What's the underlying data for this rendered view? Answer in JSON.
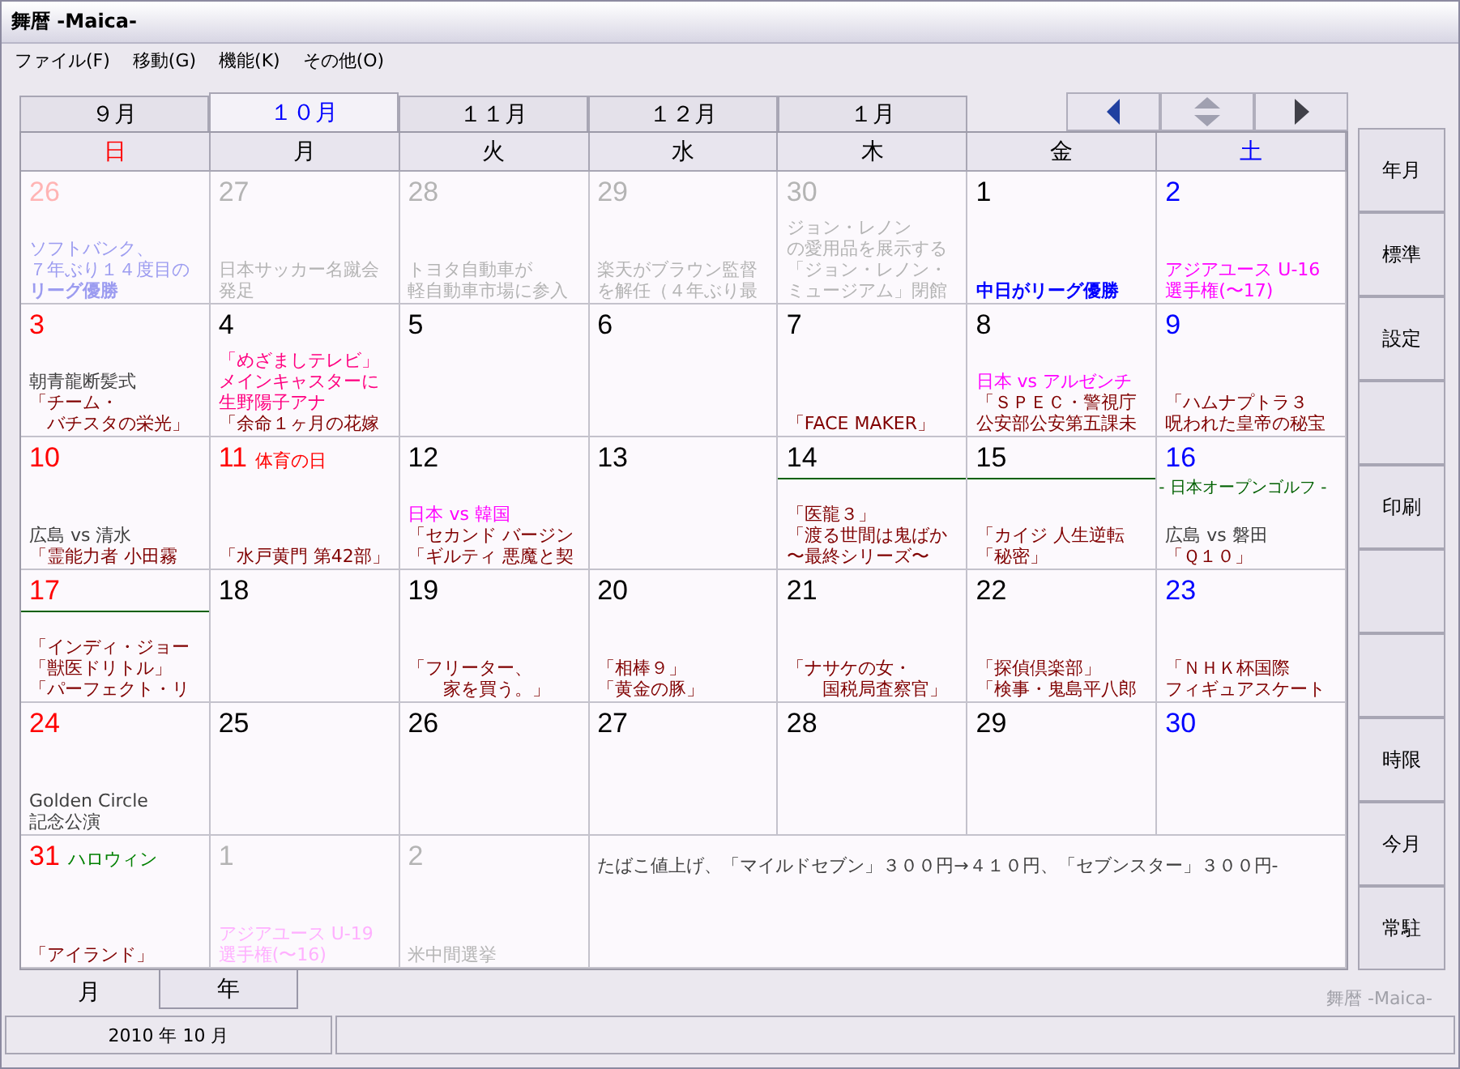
{
  "window": {
    "title": "舞暦 -Maica-"
  },
  "menu": [
    "ファイル(F)",
    "移動(G)",
    "機能(K)",
    "その他(O)"
  ],
  "month_tabs": [
    {
      "label": "９月",
      "selected": false
    },
    {
      "label": "１０月",
      "selected": true
    },
    {
      "label": "１１月",
      "selected": false
    },
    {
      "label": "１２月",
      "selected": false
    },
    {
      "label": "１月",
      "selected": false
    }
  ],
  "weekdays": [
    {
      "label": "日",
      "kind": "sunday"
    },
    {
      "label": "月",
      "kind": "weekday"
    },
    {
      "label": "火",
      "kind": "weekday"
    },
    {
      "label": "水",
      "kind": "weekday"
    },
    {
      "label": "木",
      "kind": "weekday"
    },
    {
      "label": "金",
      "kind": "weekday"
    },
    {
      "label": "土",
      "kind": "saturday"
    }
  ],
  "cells": [
    {
      "kind": "day",
      "day": {
        "text": "26",
        "color": "#ffb4b4"
      },
      "events": [
        {
          "text": "ソフトバンク、",
          "color": "#9c9cf0"
        },
        {
          "text": "７年ぶり１４度目の",
          "color": "#9c9cf0"
        },
        {
          "text": "リーグ優勝",
          "color": "#9c9cf0",
          "bold": true
        }
      ]
    },
    {
      "kind": "day",
      "day": {
        "text": "27",
        "color": "#b4b4b4"
      },
      "events": [
        {
          "text": "日本サッカー名蹴会",
          "color": "#b4b4b4"
        },
        {
          "text": "発足",
          "color": "#b4b4b4"
        }
      ]
    },
    {
      "kind": "day",
      "day": {
        "text": "28",
        "color": "#b4b4b4"
      },
      "events": [
        {
          "text": "トヨタ自動車が",
          "color": "#b4b4b4"
        },
        {
          "text": "軽自動車市場に参入",
          "color": "#b4b4b4"
        }
      ]
    },
    {
      "kind": "day",
      "day": {
        "text": "29",
        "color": "#b4b4b4"
      },
      "events": [
        {
          "text": "楽天がブラウン監督",
          "color": "#b4b4b4"
        },
        {
          "text": "を解任（４年ぶり最",
          "color": "#b4b4b4"
        }
      ]
    },
    {
      "kind": "day",
      "day": {
        "text": "30",
        "color": "#b4b4b4"
      },
      "events": [
        {
          "text": "ジョン・レノン",
          "color": "#b4b4b4"
        },
        {
          "text": "の愛用品を展示する",
          "color": "#b4b4b4"
        },
        {
          "text": "「ジョン・レノン・",
          "color": "#b4b4b4"
        },
        {
          "text": "ミュージアム」閉館",
          "color": "#b4b4b4"
        }
      ]
    },
    {
      "kind": "day",
      "day": {
        "text": "1",
        "color": "#000000"
      },
      "events": [
        {
          "text": "中日がリーグ優勝",
          "color": "#0000ff",
          "bold": true
        }
      ]
    },
    {
      "kind": "day",
      "day": {
        "text": "2",
        "color": "#0000ff"
      },
      "events": [
        {
          "text": "アジアユース U-16",
          "color": "#ff00ff"
        },
        {
          "text": "選手権(〜17)",
          "color": "#ff00ff"
        }
      ]
    },
    {
      "kind": "day",
      "day": {
        "text": "3",
        "color": "#ff0000"
      },
      "events": [
        {
          "text": "朝青龍断髪式",
          "color": "#404040"
        },
        {
          "text": "「チーム・",
          "color": "#800000"
        },
        {
          "text": "　バチスタの栄光」",
          "color": "#800000"
        }
      ]
    },
    {
      "kind": "day",
      "day": {
        "text": "4",
        "color": "#000000"
      },
      "events": [
        {
          "text": "「めざましテレビ」",
          "color": "#ff0080"
        },
        {
          "text": "メインキャスターに",
          "color": "#ff0080"
        },
        {
          "text": "生野陽子アナ",
          "color": "#ff0080"
        },
        {
          "text": "「余命１ヶ月の花嫁",
          "color": "#800000"
        }
      ]
    },
    {
      "kind": "day",
      "day": {
        "text": "5",
        "color": "#000000"
      }
    },
    {
      "kind": "day",
      "day": {
        "text": "6",
        "color": "#000000"
      }
    },
    {
      "kind": "day",
      "day": {
        "text": "7",
        "color": "#000000"
      },
      "events": [
        {
          "text": "「FACE MAKER」",
          "color": "#800000"
        }
      ]
    },
    {
      "kind": "day",
      "day": {
        "text": "8",
        "color": "#000000"
      },
      "events": [
        {
          "text": "日本 vs アルゼンチ",
          "color": "#ff00ff"
        },
        {
          "text": "「ＳＰＥＣ・警視庁",
          "color": "#800000"
        },
        {
          "text": "公安部公安第五課未",
          "color": "#800000"
        }
      ]
    },
    {
      "kind": "day",
      "day": {
        "text": "9",
        "color": "#0000ff"
      },
      "events": [
        {
          "text": "「ハムナプトラ３",
          "color": "#800000"
        },
        {
          "text": "呪われた皇帝の秘宝",
          "color": "#800000"
        }
      ]
    },
    {
      "kind": "day",
      "day": {
        "text": "10",
        "color": "#ff0000"
      },
      "events": [
        {
          "text": "広島 vs 清水",
          "color": "#404040"
        },
        {
          "text": "「霊能力者 小田霧",
          "color": "#800000"
        }
      ]
    },
    {
      "kind": "day",
      "day": {
        "text": "11",
        "color": "#ff0000"
      },
      "label": {
        "text": "体育の日",
        "color": "#ff0000"
      },
      "events": [
        {
          "text": "「水戸黄門 第42部」",
          "color": "#800000"
        }
      ]
    },
    {
      "kind": "day",
      "day": {
        "text": "12",
        "color": "#000000"
      },
      "events": [
        {
          "text": "日本 vs 韓国",
          "color": "#ff00ff"
        },
        {
          "text": "「セカンド バージン",
          "color": "#800000"
        },
        {
          "text": "「ギルティ 悪魔と契",
          "color": "#800000"
        }
      ]
    },
    {
      "kind": "day",
      "day": {
        "text": "13",
        "color": "#000000"
      }
    },
    {
      "kind": "day",
      "day": {
        "text": "14",
        "color": "#000000"
      },
      "banner": {
        "kind": "line",
        "color": "#006000"
      },
      "events": [
        {
          "text": "「医龍３」",
          "color": "#800000"
        },
        {
          "text": "「渡る世間は鬼ばか",
          "color": "#800000"
        },
        {
          "text": "〜最終シリーズ〜",
          "color": "#800000"
        }
      ]
    },
    {
      "kind": "day",
      "day": {
        "text": "15",
        "color": "#000000"
      },
      "banner": {
        "kind": "line",
        "color": "#006000"
      },
      "events": [
        {
          "text": "「カイジ 人生逆転",
          "color": "#800000"
        },
        {
          "text": "「秘密」",
          "color": "#800000"
        }
      ]
    },
    {
      "kind": "day",
      "day": {
        "text": "16",
        "color": "#0000ff"
      },
      "banner": {
        "kind": "text",
        "text": "- 日本オープンゴルフ -",
        "color": "#006000"
      },
      "events": [
        {
          "text": "広島 vs 磐田",
          "color": "#404040"
        },
        {
          "text": "「Ｑ１０」",
          "color": "#800000"
        }
      ]
    },
    {
      "kind": "day",
      "day": {
        "text": "17",
        "color": "#ff0000"
      },
      "banner": {
        "kind": "line",
        "color": "#006000"
      },
      "events": [
        {
          "text": "「インディ・ジョー",
          "color": "#800000"
        },
        {
          "text": "「獣医ドリトル」",
          "color": "#800000"
        },
        {
          "text": "「パーフェクト・リ",
          "color": "#800000"
        }
      ]
    },
    {
      "kind": "day",
      "day": {
        "text": "18",
        "color": "#000000"
      }
    },
    {
      "kind": "day",
      "day": {
        "text": "19",
        "color": "#000000"
      },
      "events": [
        {
          "text": "「フリーター、",
          "color": "#800000"
        },
        {
          "text": "　　家を買う。」",
          "color": "#800000"
        }
      ]
    },
    {
      "kind": "day",
      "day": {
        "text": "20",
        "color": "#000000"
      },
      "events": [
        {
          "text": "「相棒９」",
          "color": "#800000"
        },
        {
          "text": "「黄金の豚」",
          "color": "#800000"
        }
      ]
    },
    {
      "kind": "day",
      "day": {
        "text": "21",
        "color": "#000000"
      },
      "events": [
        {
          "text": "「ナサケの女・",
          "color": "#800000"
        },
        {
          "text": "　　国税局査察官」",
          "color": "#800000"
        }
      ]
    },
    {
      "kind": "day",
      "day": {
        "text": "22",
        "color": "#000000"
      },
      "events": [
        {
          "text": "「探偵倶楽部」",
          "color": "#800000"
        },
        {
          "text": "「検事・鬼島平八郎",
          "color": "#800000"
        }
      ]
    },
    {
      "kind": "day",
      "day": {
        "text": "23",
        "color": "#0000ff"
      },
      "events": [
        {
          "text": "「ＮＨＫ杯国際",
          "color": "#800000"
        },
        {
          "text": "フィギュアスケート",
          "color": "#800000"
        }
      ]
    },
    {
      "kind": "day",
      "day": {
        "text": "24",
        "color": "#ff0000"
      },
      "events": [
        {
          "text": "Golden Circle",
          "color": "#404040"
        },
        {
          "text": "記念公演",
          "color": "#404040"
        }
      ]
    },
    {
      "kind": "day",
      "day": {
        "text": "25",
        "color": "#000000"
      }
    },
    {
      "kind": "day",
      "day": {
        "text": "26",
        "color": "#000000"
      }
    },
    {
      "kind": "day",
      "day": {
        "text": "27",
        "color": "#000000"
      }
    },
    {
      "kind": "day",
      "day": {
        "text": "28",
        "color": "#000000"
      }
    },
    {
      "kind": "day",
      "day": {
        "text": "29",
        "color": "#000000"
      }
    },
    {
      "kind": "day",
      "day": {
        "text": "30",
        "color": "#0000ff"
      }
    },
    {
      "kind": "day",
      "day": {
        "text": "31",
        "color": "#ff0000"
      },
      "label": {
        "text": "ハロウィン",
        "color": "#008000"
      },
      "events": [
        {
          "text": "「アイランド」",
          "color": "#800000"
        }
      ]
    },
    {
      "kind": "day",
      "day": {
        "text": "1",
        "color": "#b4b4b4"
      },
      "events": [
        {
          "text": "アジアユース U-19",
          "color": "#ffb0ff"
        },
        {
          "text": "選手権(〜16)",
          "color": "#ffb0ff"
        }
      ]
    },
    {
      "kind": "day",
      "day": {
        "text": "2",
        "color": "#b4b4b4"
      },
      "events": [
        {
          "text": "米中間選挙",
          "color": "#b4b4b4"
        }
      ]
    },
    {
      "kind": "note",
      "text": "たばこ値上げ、「マイルドセブン」３００円→４１０円、「セブンスター」３００円-",
      "color": "#404040"
    }
  ],
  "side_buttons": [
    {
      "kind": "label",
      "label": "年月"
    },
    {
      "kind": "label",
      "label": "標準"
    },
    {
      "kind": "label",
      "label": "設定"
    },
    {
      "kind": "blank"
    },
    {
      "kind": "label",
      "label": "印刷"
    },
    {
      "kind": "blank"
    },
    {
      "kind": "blank"
    },
    {
      "kind": "label",
      "label": "時限"
    },
    {
      "kind": "label",
      "label": "今月"
    },
    {
      "kind": "label",
      "label": "常駐"
    }
  ],
  "view_tabs": [
    {
      "label": "月",
      "selected": true
    },
    {
      "label": "年",
      "selected": false
    }
  ],
  "footer_brand": "舞暦 -Maica-",
  "status_bar": "2010 年 10 月"
}
